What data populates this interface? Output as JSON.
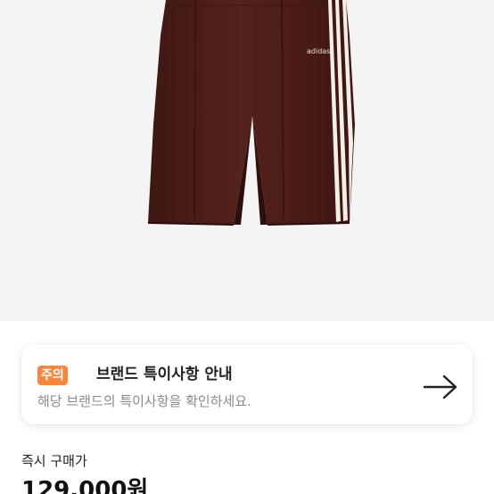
{
  "product": {
    "image_alt_icon": "shorts-product-image",
    "logo_text": "adidas"
  },
  "notice": {
    "badge": "주의",
    "title": "브랜드 특이사항 안내",
    "description": "해당 브랜드의 특이사항을 확인하세요.",
    "arrow_icon": "arrow-right-icon"
  },
  "price": {
    "label": "즉시 구매가",
    "value": "129,000원"
  },
  "colors": {
    "hero_bg": "#f4f4f4",
    "badge": "#f7873d",
    "shorts": "#4a1d18"
  }
}
